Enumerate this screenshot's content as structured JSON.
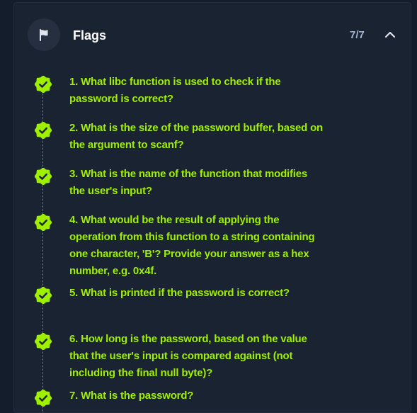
{
  "header": {
    "title": "Flags",
    "count": "7/7",
    "flag_icon": "flag-icon",
    "collapse_icon": "chevron-up-icon"
  },
  "colors": {
    "page_bg": "#141d2b",
    "panel_bg": "#1a2332",
    "accent": "#9fef00",
    "muted": "#a4b1cd"
  },
  "questions": [
    {
      "text": "1. What libc function is used to check if the password is correct?",
      "completed": true
    },
    {
      "text": "2. What is the size of the password buffer, based on the argument to scanf?",
      "completed": true
    },
    {
      "text": "3. What is the name of the function that modifies the user's input?",
      "completed": true
    },
    {
      "text": "4. What would be the result of applying the operation from this function to a string containing one character, 'B'? Provide your answer as a hex number, e.g. 0x4f.",
      "completed": true
    },
    {
      "text": "5. What is printed if the password is correct?",
      "completed": true
    },
    {
      "text": "6. How long is the password, based on the value that the user's input is compared against (not including the final null byte)?",
      "completed": true
    },
    {
      "text": "7. What is the password?",
      "completed": true
    }
  ]
}
